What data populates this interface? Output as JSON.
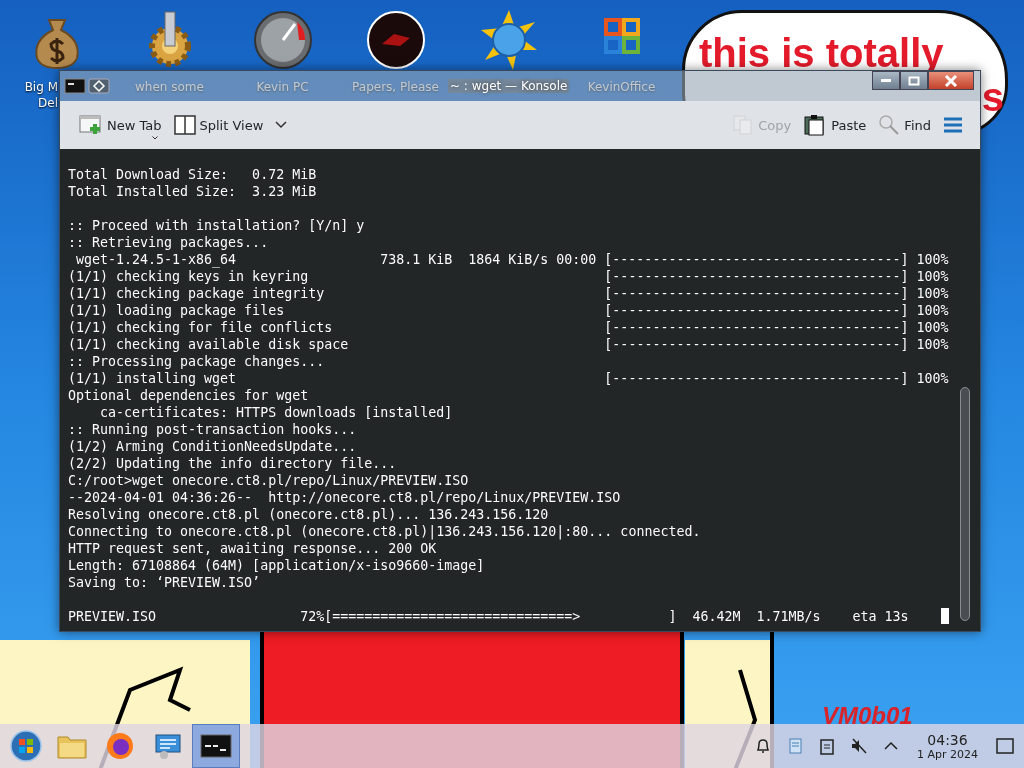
{
  "desktop_icons": [
    {
      "kind": "money-bag",
      "label": "Big M",
      "label_2": "Del"
    },
    {
      "kind": "gear",
      "label": "when some"
    },
    {
      "kind": "gauge",
      "label": "Kevin PC"
    },
    {
      "kind": "dark-disc",
      "label": "Papers, Please"
    },
    {
      "kind": "sun-globe"
    },
    {
      "kind": "squares",
      "label": "KevinOffice"
    }
  ],
  "speech_bubble": {
    "lines": [
      "this is totally",
      "s"
    ]
  },
  "wallpaper_text": "VM0b01",
  "window": {
    "title": "~ : wget — Konsole"
  },
  "toolbar": {
    "buttons": [
      {
        "kind": "new-tab",
        "label": "New Tab",
        "disabled": false
      },
      {
        "kind": "split-view",
        "label": "Split View",
        "disabled": false
      },
      {
        "kind": "copy",
        "label": "Copy",
        "disabled": true
      },
      {
        "kind": "paste",
        "label": "Paste",
        "disabled": false
      },
      {
        "kind": "find",
        "label": "Find",
        "disabled": false
      },
      {
        "kind": "menu",
        "disabled": false
      }
    ]
  },
  "terminal": {
    "lines": [
      {
        "kind": "text",
        "text": "Total Download Size:   0.72 MiB"
      },
      {
        "kind": "text",
        "text": "Total Installed Size:  3.23 MiB"
      },
      {
        "kind": "blank"
      },
      {
        "kind": "text",
        "text": ":: Proceed with installation? [Y/n] y"
      },
      {
        "kind": "text",
        "text": ":: Retrieving packages..."
      },
      {
        "kind": "progress",
        "label": " wget-1.24.5-1-x86_64",
        "stats": "738.1 KiB  1864 KiB/s 00:00",
        "bar": "[------------------------------------]",
        "percent": "100%"
      },
      {
        "kind": "progress",
        "label": "(1/1) checking keys in keyring",
        "bar": "[------------------------------------]",
        "percent": "100%"
      },
      {
        "kind": "progress",
        "label": "(1/1) checking package integrity",
        "bar": "[------------------------------------]",
        "percent": "100%"
      },
      {
        "kind": "progress",
        "label": "(1/1) loading package files",
        "bar": "[------------------------------------]",
        "percent": "100%"
      },
      {
        "kind": "progress",
        "label": "(1/1) checking for file conflicts",
        "bar": "[------------------------------------]",
        "percent": "100%"
      },
      {
        "kind": "progress",
        "label": "(1/1) checking available disk space",
        "bar": "[------------------------------------]",
        "percent": "100%"
      },
      {
        "kind": "text",
        "text": ":: Processing package changes..."
      },
      {
        "kind": "progress",
        "label": "(1/1) installing wget",
        "bar": "[------------------------------------]",
        "percent": "100%"
      },
      {
        "kind": "text",
        "text": "Optional dependencies for wget"
      },
      {
        "kind": "text",
        "text": "    ca-certificates: HTTPS downloads [installed]"
      },
      {
        "kind": "text",
        "text": ":: Running post-transaction hooks..."
      },
      {
        "kind": "text",
        "text": "(1/2) Arming ConditionNeedsUpdate..."
      },
      {
        "kind": "text",
        "text": "(2/2) Updating the info directory file..."
      },
      {
        "kind": "text",
        "text": "C:/root>wget onecore.ct8.pl/repo/Linux/PREVIEW.ISO"
      },
      {
        "kind": "text",
        "text": "--2024-04-01 04:36:26--  http://onecore.ct8.pl/repo/Linux/PREVIEW.ISO"
      },
      {
        "kind": "text",
        "text": "Resolving onecore.ct8.pl (onecore.ct8.pl)... 136.243.156.120"
      },
      {
        "kind": "text",
        "text": "Connecting to onecore.ct8.pl (onecore.ct8.pl)|136.243.156.120|:80... connected."
      },
      {
        "kind": "text",
        "text": "HTTP request sent, awaiting response... 200 OK"
      },
      {
        "kind": "text",
        "text": "Length: 67108864 (64M) [application/x-iso9660-image]"
      },
      {
        "kind": "text",
        "text": "Saving to: ‘PREVIEW.ISO’"
      },
      {
        "kind": "blank"
      },
      {
        "kind": "download",
        "name": "PREVIEW.ISO",
        "percent": "72%",
        "bar": "[==============================>           ]",
        "size": "46.42M",
        "rate": "1.71MB/s",
        "eta": "eta 13s"
      }
    ]
  },
  "taskbar": {
    "apps": [
      {
        "kind": "folder",
        "selected": false
      },
      {
        "kind": "firefox",
        "selected": false
      },
      {
        "kind": "network",
        "selected": false
      },
      {
        "kind": "terminal",
        "selected": true
      }
    ],
    "tray": [
      {
        "kind": "bell"
      },
      {
        "kind": "notes"
      },
      {
        "kind": "clipboard"
      },
      {
        "kind": "speaker-muted"
      },
      {
        "kind": "chevron"
      }
    ],
    "clock": {
      "time": "04:36",
      "date": "1 Apr 2024"
    }
  }
}
